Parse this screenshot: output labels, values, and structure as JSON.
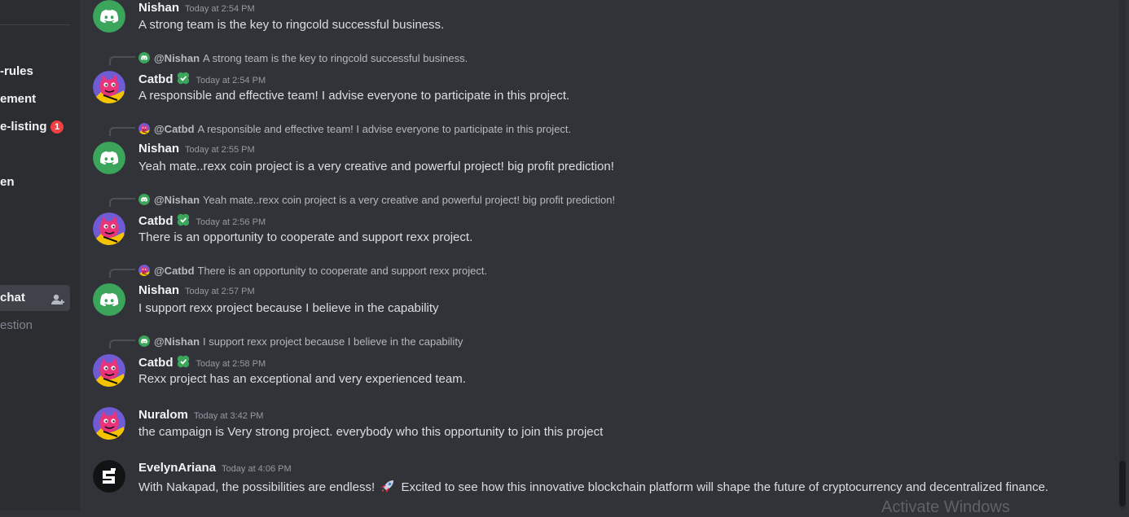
{
  "sidebar": {
    "items": [
      {
        "label": "-rules"
      },
      {
        "label": "ement"
      },
      {
        "label": "e-listing",
        "badge": "1"
      },
      {
        "label": "en"
      },
      {
        "label": "chat"
      },
      {
        "label": "estion"
      }
    ]
  },
  "messages": [
    {
      "author": "Nishan",
      "time": "Today at 2:54 PM",
      "text": "A strong team is the key to ringcold successful business."
    },
    {
      "reply_to": "@Nishan",
      "reply_text": "A strong team is the key to ringcold successful business.",
      "author": "Catbd",
      "time": "Today at 2:54 PM",
      "text": "A responsible and effective team! I advise everyone to participate in this project."
    },
    {
      "reply_to": "@Catbd",
      "reply_text": "A responsible and effective team! I advise everyone to participate in this project.",
      "author": "Nishan",
      "time": "Today at 2:55 PM",
      "text": "Yeah mate..rexx coin project is a very creative and powerful project! big profit prediction!"
    },
    {
      "reply_to": "@Nishan",
      "reply_text": "Yeah mate..rexx coin project is a very creative and powerful project! big profit prediction!",
      "author": "Catbd",
      "time": "Today at 2:56 PM",
      "text": "There is an opportunity to cooperate and support rexx  project."
    },
    {
      "reply_to": "@Catbd",
      "reply_text": "There is an opportunity to cooperate and support rexx project.",
      "author": "Nishan",
      "time": "Today at 2:57 PM",
      "text": "I support rexx project because I believe in the capability"
    },
    {
      "reply_to": "@Nishan",
      "reply_text": "I support rexx project because I believe in the capability",
      "author": "Catbd",
      "time": "Today at 2:58 PM",
      "text": "Rexx  project has an exceptional and very experienced team."
    },
    {
      "author": "Nuralom",
      "time": "Today at 3:42 PM",
      "text": "the campaign is Very strong project. everybody who this opportunity to join this project"
    },
    {
      "author": "EvelynAriana",
      "time": "Today at 4:06 PM",
      "text_before": "With Nakapad, the possibilities are endless!",
      "emoji": "rocket",
      "text_after": "Excited to see how this innovative blockchain platform will shape the future of cryptocurrency and decentralized finance."
    }
  ],
  "watermark": "Activate Windows",
  "colors": {
    "background": "#313338",
    "sidebar": "#2b2d31",
    "discord_green": "#3ba55c",
    "badge_red": "#f23f43"
  }
}
